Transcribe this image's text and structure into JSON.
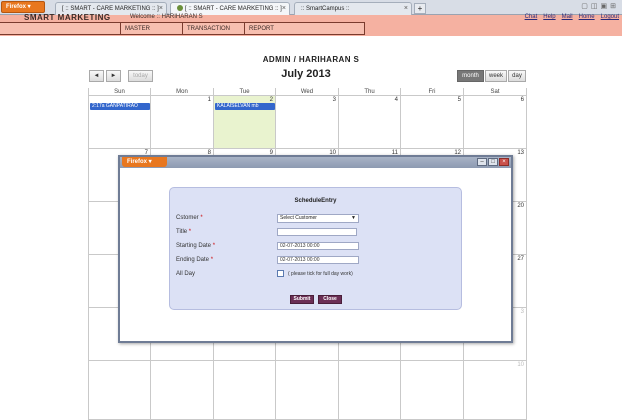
{
  "browser": {
    "menu_label": "Firefox ▾",
    "tabs": [
      {
        "label": "[ :: SMART - CARE MARKETING :: ]",
        "active": false
      },
      {
        "label": "[ :: SMART - CARE MARKETING :: ]",
        "active": true
      },
      {
        "label": ":: SmartCampus ::",
        "active": false
      }
    ],
    "new_tab": "+"
  },
  "app": {
    "brand": "SMART MARKETING",
    "welcome": "Welcome :: HARIHARAN S",
    "top_links": [
      "Chat",
      "Help",
      "Mail",
      "Home",
      "Logout"
    ],
    "menu": [
      "MASTER",
      "TRANSACTION",
      "REPORT"
    ],
    "user_line": "ADMIN   /   HARIHARAN S"
  },
  "calendar": {
    "prev": "◄",
    "next": "►",
    "today": "today",
    "title": "July 2013",
    "views": [
      {
        "label": "month",
        "active": true
      },
      {
        "label": "week",
        "active": false
      },
      {
        "label": "day",
        "active": false
      }
    ],
    "days_of_week": [
      "Sun",
      "Mon",
      "Tue",
      "Wed",
      "Thu",
      "Fri",
      "Sat"
    ],
    "week1": [
      "",
      "1",
      "2",
      "3",
      "4",
      "5",
      "6"
    ],
    "visible_numbers": [
      "7",
      "8",
      "9",
      "10",
      "11",
      "12",
      "13"
    ],
    "right_column_numbers": [
      "20",
      "27",
      "3",
      "10"
    ],
    "events": [
      {
        "label": "2:17a GANPATIRAO"
      },
      {
        "label": "KALAISELVAN mb"
      }
    ]
  },
  "modal": {
    "menu_label": "Firefox ▾",
    "form_title": "ScheduleEntry",
    "fields": {
      "customer_label": "Cstomer",
      "customer_value": "Select Customer",
      "title_label": "Title",
      "title_value": "",
      "start_label": "Starting Date",
      "start_value": "02-07-2013 00:00",
      "end_label": "Ending Date",
      "end_value": "02-07-2013 00:00",
      "allday_label": "All Day",
      "allday_hint": "( please tick for full day work)"
    },
    "required_mark": "*",
    "submit_label": "Submit",
    "close_label": "Close"
  }
}
